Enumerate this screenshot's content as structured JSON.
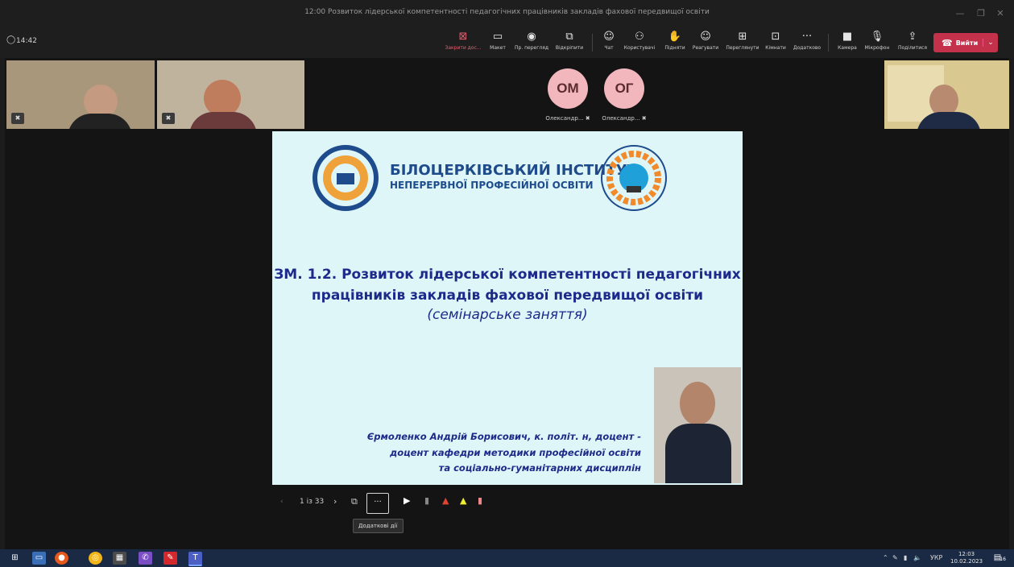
{
  "window": {
    "title": "12:00 Розвиток лідерської компетентності педагогічних працівників закладів фахової передвищої освіти"
  },
  "toolbar": {
    "timer": "14:42",
    "buttons": [
      {
        "icon": "close-square-icon",
        "label": "Закрити дос..."
      },
      {
        "icon": "layout-icon",
        "label": "Макет"
      },
      {
        "icon": "eye-icon",
        "label": "Пр. перегляд"
      },
      {
        "icon": "popout-icon",
        "label": "Відкріпити"
      },
      {
        "icon": "chat-icon",
        "label": "Чат"
      },
      {
        "icon": "people-icon",
        "label": "Користувачі"
      },
      {
        "icon": "hand-icon",
        "label": "Підняти"
      },
      {
        "icon": "emoji-icon",
        "label": "Реагувати"
      },
      {
        "icon": "grid-icon",
        "label": "Переглянути"
      },
      {
        "icon": "rooms-icon",
        "label": "Кімнати"
      },
      {
        "icon": "more-icon",
        "label": "Додатково"
      },
      {
        "icon": "camera-icon",
        "label": "Камера"
      },
      {
        "icon": "mic-icon",
        "label": "Мікрофон"
      },
      {
        "icon": "share-icon",
        "label": "Поділитися"
      }
    ],
    "leave_label": "Вийти"
  },
  "participants": [
    {
      "initials": "ОМ",
      "name": "Олександр...",
      "avatar_color": "#f2b6bd"
    },
    {
      "initials": "ОГ",
      "name": "Олександр...",
      "avatar_color": "#f2b6bd"
    }
  ],
  "slide": {
    "institute_line1": "БІЛОЦЕРКІВСЬКИЙ ІНСТИТУТ",
    "institute_line2": "НЕПЕРЕРВНОЇ ПРОФЕСІЙНОЇ ОСВІТИ",
    "title_line1": "ЗМ. 1.2. Розвиток лідерської компетентності педагогічних",
    "title_line2": "працівників закладів фахової передвищої освіти",
    "subtitle": "(семінарське заняття)",
    "author_line1": "Єрмоленко Андрій Борисович, к. політ. н, доцент -",
    "author_line2": "доцент кафедри методики професійної освіти",
    "author_line3": "та соціально-гуманітарних дисциплін"
  },
  "slide_nav": {
    "page_indicator": "1 із 33",
    "more_label": "···",
    "tooltip": "Додаткові дії"
  },
  "taskbar": {
    "language": "УКР",
    "time": "12:03",
    "date": "10.02.2023",
    "notification_count": "16"
  },
  "colors": {
    "accent_leave": "#c4314b",
    "slide_bg": "#dff6f8",
    "title_blue": "#1d2a8a",
    "avatar_pink": "#f2b6bd"
  }
}
